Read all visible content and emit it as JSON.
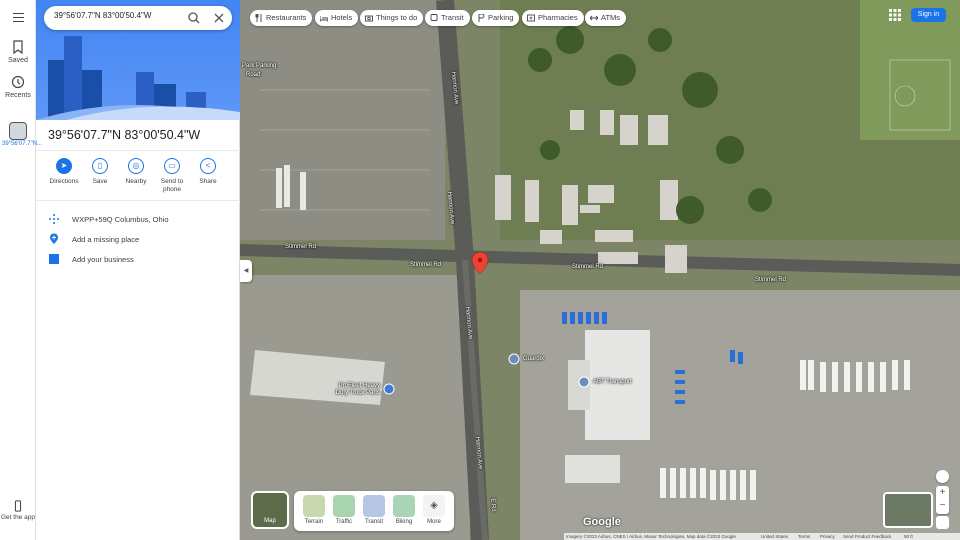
{
  "search": {
    "value": "39°56'07.7\"N 83°00'50.4\"W"
  },
  "rail": {
    "saved": "Saved",
    "recents": "Recents",
    "recent_item": "39°56'07.7\"N...",
    "get_app": "Get the app"
  },
  "place": {
    "title": "39°56'07.7\"N 83°00'50.4\"W"
  },
  "actions": [
    {
      "label": "Directions",
      "icon": "directions-icon"
    },
    {
      "label": "Save",
      "icon": "bookmark-icon"
    },
    {
      "label": "Nearby",
      "icon": "nearby-icon"
    },
    {
      "label": "Send to phone",
      "icon": "send-to-phone-icon"
    },
    {
      "label": "Share",
      "icon": "share-icon"
    }
  ],
  "info": {
    "plus_code": "WXPP+59Q Columbus, Ohio",
    "add_missing": "Add a missing place",
    "add_business": "Add your business"
  },
  "chips": [
    {
      "label": "Restaurants",
      "icon": "restaurant-icon"
    },
    {
      "label": "Hotels",
      "icon": "hotel-icon"
    },
    {
      "label": "Things to do",
      "icon": "camera-icon"
    },
    {
      "label": "Transit",
      "icon": "transit-icon"
    },
    {
      "label": "Parking",
      "icon": "parking-icon"
    },
    {
      "label": "Pharmacies",
      "icon": "pharmacy-icon"
    },
    {
      "label": "ATMs",
      "icon": "atm-icon"
    }
  ],
  "header": {
    "sign_in": "Sign in"
  },
  "map_labels": {
    "park": "Park Parking",
    "road": "Road",
    "harmon_ave": "Harmon Ave",
    "stimmel_rd": "Stimmel Rd",
    "harmon_ave_2": "Harmon Ave",
    "stimmel_rd_2": "Stimmel Rd",
    "stimmel_rd_3": "Stimmel Rd",
    "stimmel_rd_4": "Stimmel Rd",
    "guardix": "Guardix",
    "abt": "ABT Transport",
    "profleet": "ProFleet Heavy Duty Truck Parts",
    "harmon_ave_3": "Harmon Ave",
    "harmon_ave_4": "Harmon Ave",
    "ehe": "E Rd"
  },
  "layers": {
    "map": "Map",
    "terrain": "Terrain",
    "traffic": "Traffic",
    "transit": "Transit",
    "biking": "Biking",
    "more": "More"
  },
  "footer": {
    "imagery": "Imagery ©2023 Airbus, CNES / Airbus, Maxar Technologies, Map data ©2023 Google",
    "country": "United States",
    "terms": "Terms",
    "privacy": "Privacy",
    "feedback": "Send Product Feedback",
    "scale": "50 ft"
  },
  "logo": "Google",
  "colors": {
    "accent": "#1a73e8",
    "pin": "#ea4335"
  }
}
